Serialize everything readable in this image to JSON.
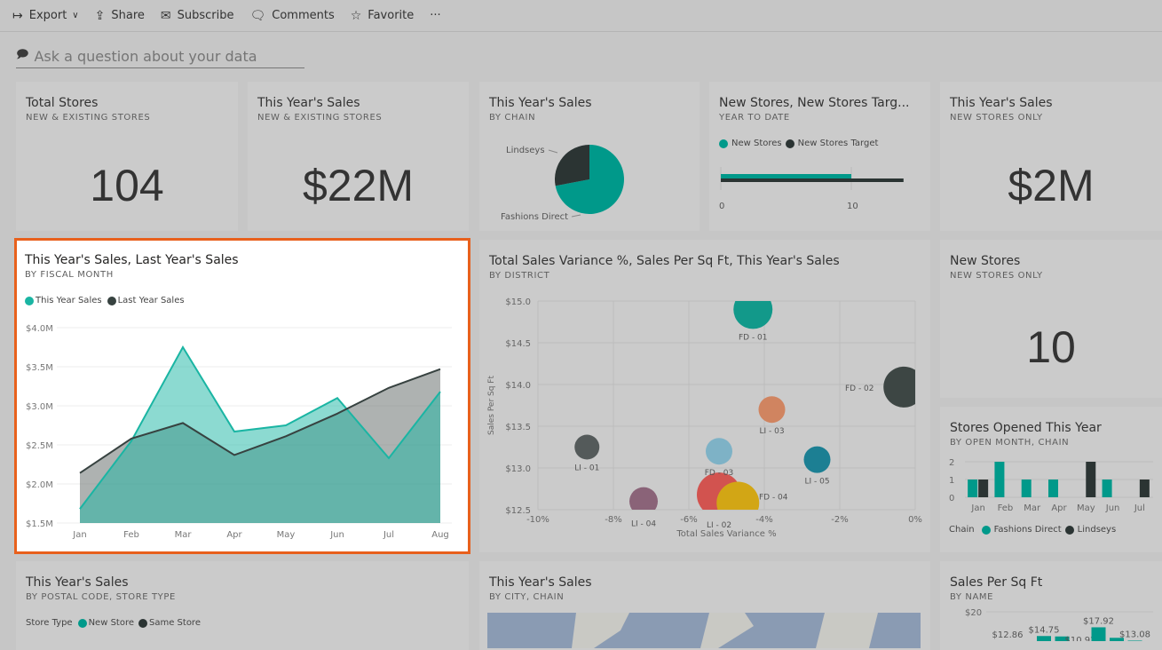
{
  "toolbar": {
    "items": [
      {
        "label": "Export",
        "icon": "export-arrow-icon"
      },
      {
        "label": "Share",
        "icon": "share-icon"
      },
      {
        "label": "Subscribe",
        "icon": "envelope-icon"
      },
      {
        "label": "Comments",
        "icon": "comment-icon"
      },
      {
        "label": "Favorite",
        "icon": "star-icon"
      }
    ],
    "more": "···"
  },
  "qa": {
    "placeholder": "Ask a question about your data"
  },
  "colors": {
    "teal": "#00998a",
    "dark": "#2b3433",
    "accent": "#e8601c",
    "bg": "#c6c6c6"
  },
  "tiles": {
    "total_stores": {
      "title": "Total Stores",
      "subtitle": "NEW & EXISTING STORES",
      "value": "104"
    },
    "ty_sales": {
      "title": "This Year's Sales",
      "subtitle": "NEW & EXISTING STORES",
      "value": "$22M"
    },
    "by_chain": {
      "title": "This Year's Sales",
      "subtitle": "BY CHAIN"
    },
    "new_stores_target": {
      "title": "New Stores, New Stores Targ...",
      "subtitle": "YEAR TO DATE"
    },
    "ty_new": {
      "title": "This Year's Sales",
      "subtitle": "NEW STORES ONLY",
      "value": "$2M"
    },
    "line": {
      "title": "This Year's Sales, Last Year's Sales",
      "subtitle": "BY FISCAL MONTH"
    },
    "scatter": {
      "title": "Total Sales Variance %, Sales Per Sq Ft, This Year's Sales",
      "subtitle": "BY DISTRICT"
    },
    "new_stores": {
      "title": "New Stores",
      "subtitle": "NEW STORES ONLY",
      "value": "10"
    },
    "opened": {
      "title": "Stores Opened This Year",
      "subtitle": "BY OPEN MONTH, CHAIN"
    },
    "postal": {
      "title": "This Year's Sales",
      "subtitle": "BY POSTAL CODE, STORE TYPE",
      "legend_title": "Store Type",
      "legend": [
        "New Store",
        "Same Store"
      ]
    },
    "city": {
      "title": "This Year's Sales",
      "subtitle": "BY CITY, CHAIN"
    },
    "sqft": {
      "title": "Sales Per Sq Ft",
      "subtitle": "BY NAME"
    }
  },
  "chart_data": [
    {
      "id": "pie",
      "type": "pie",
      "slices": [
        {
          "name": "Fashions Direct",
          "value": 72,
          "color": "#00998a"
        },
        {
          "name": "Lindseys",
          "value": 28,
          "color": "#2b3433"
        }
      ]
    },
    {
      "id": "bullet",
      "type": "bar",
      "orientation": "horizontal",
      "series": [
        {
          "name": "New Stores",
          "values": [
            10
          ],
          "color": "#00998a"
        },
        {
          "name": "New Stores Target",
          "values": [
            14
          ],
          "color": "#2b3433"
        }
      ],
      "xticks": [
        "0",
        "10"
      ],
      "xlim": [
        0,
        14
      ]
    },
    {
      "id": "line",
      "type": "area",
      "categories": [
        "Jan",
        "Feb",
        "Mar",
        "Apr",
        "May",
        "Jun",
        "Jul",
        "Aug"
      ],
      "series": [
        {
          "name": "This Year Sales",
          "color": "#1ab5a3",
          "values": [
            1.68,
            2.55,
            3.75,
            2.67,
            2.75,
            3.1,
            2.33,
            3.18
          ]
        },
        {
          "name": "Last Year Sales",
          "color": "#374240",
          "values": [
            2.14,
            2.58,
            2.78,
            2.37,
            2.61,
            2.9,
            3.23,
            3.47
          ]
        }
      ],
      "yticks": [
        "$1.5M",
        "$2.0M",
        "$2.5M",
        "$3.0M",
        "$3.5M",
        "$4.0M"
      ],
      "ylim": [
        1.5,
        4.0
      ],
      "grid": true,
      "legend": "top-left"
    },
    {
      "id": "scatter",
      "type": "scatter",
      "xlabel": "Total Sales Variance %",
      "ylabel": "Sales Per Sq Ft",
      "xlim": [
        -10,
        0
      ],
      "ylim": [
        12.5,
        15.0
      ],
      "xticks": [
        "-10%",
        "-8%",
        "-6%",
        "-4%",
        "-2%",
        "0%"
      ],
      "yticks": [
        "$12.5",
        "$13.0",
        "$13.5",
        "$14.0",
        "$14.5",
        "$15.0"
      ],
      "points": [
        {
          "label": "FD - 01",
          "x": -4.3,
          "y": 14.9,
          "size": 22,
          "color": "#12998a"
        },
        {
          "label": "FD - 02",
          "x": -0.3,
          "y": 13.97,
          "size": 23,
          "color": "#3d4644"
        },
        {
          "label": "LI - 03",
          "x": -3.8,
          "y": 13.7,
          "size": 15,
          "color": "#d08460"
        },
        {
          "label": "LI - 01",
          "x": -8.7,
          "y": 13.25,
          "size": 14,
          "color": "#545a5a"
        },
        {
          "label": "FD - 03",
          "x": -5.2,
          "y": 13.2,
          "size": 15,
          "color": "#7eb2c6"
        },
        {
          "label": "LI - 05",
          "x": -2.6,
          "y": 13.1,
          "size": 15,
          "color": "#1c7f93"
        },
        {
          "label": "LI - 04",
          "x": -7.2,
          "y": 12.6,
          "size": 16,
          "color": "#8a6378"
        },
        {
          "label": "LI - 02",
          "x": -5.2,
          "y": 12.68,
          "size": 25,
          "color": "#d2534f"
        },
        {
          "label": "FD - 04",
          "x": -4.7,
          "y": 12.58,
          "size": 24,
          "color": "#d2a615"
        }
      ]
    },
    {
      "id": "opened",
      "type": "bar",
      "categories": [
        "Jan",
        "Feb",
        "Mar",
        "Apr",
        "May",
        "Jun",
        "Jul"
      ],
      "series": [
        {
          "name": "Fashions Direct",
          "color": "#00998a",
          "values": [
            1,
            2,
            1,
            1,
            0,
            1,
            0
          ]
        },
        {
          "name": "Lindseys",
          "color": "#2b3433",
          "values": [
            1,
            0,
            0,
            0,
            2,
            0,
            1
          ]
        }
      ],
      "yticks": [
        "0",
        "1",
        "2"
      ],
      "ylim": [
        0,
        2
      ],
      "legend_title": "Chain",
      "legend": "bottom"
    },
    {
      "id": "sqft",
      "type": "bar",
      "values": [
        12.86,
        12.1,
        14.75,
        14.6,
        10.92,
        17.92,
        14.1,
        13.08
      ],
      "labels": [
        "$12.86",
        "",
        "$14.75",
        "",
        "$10.92",
        "$17.92",
        "",
        "$13.08"
      ],
      "yticks": [
        "$20"
      ],
      "color": "#00998a"
    }
  ]
}
